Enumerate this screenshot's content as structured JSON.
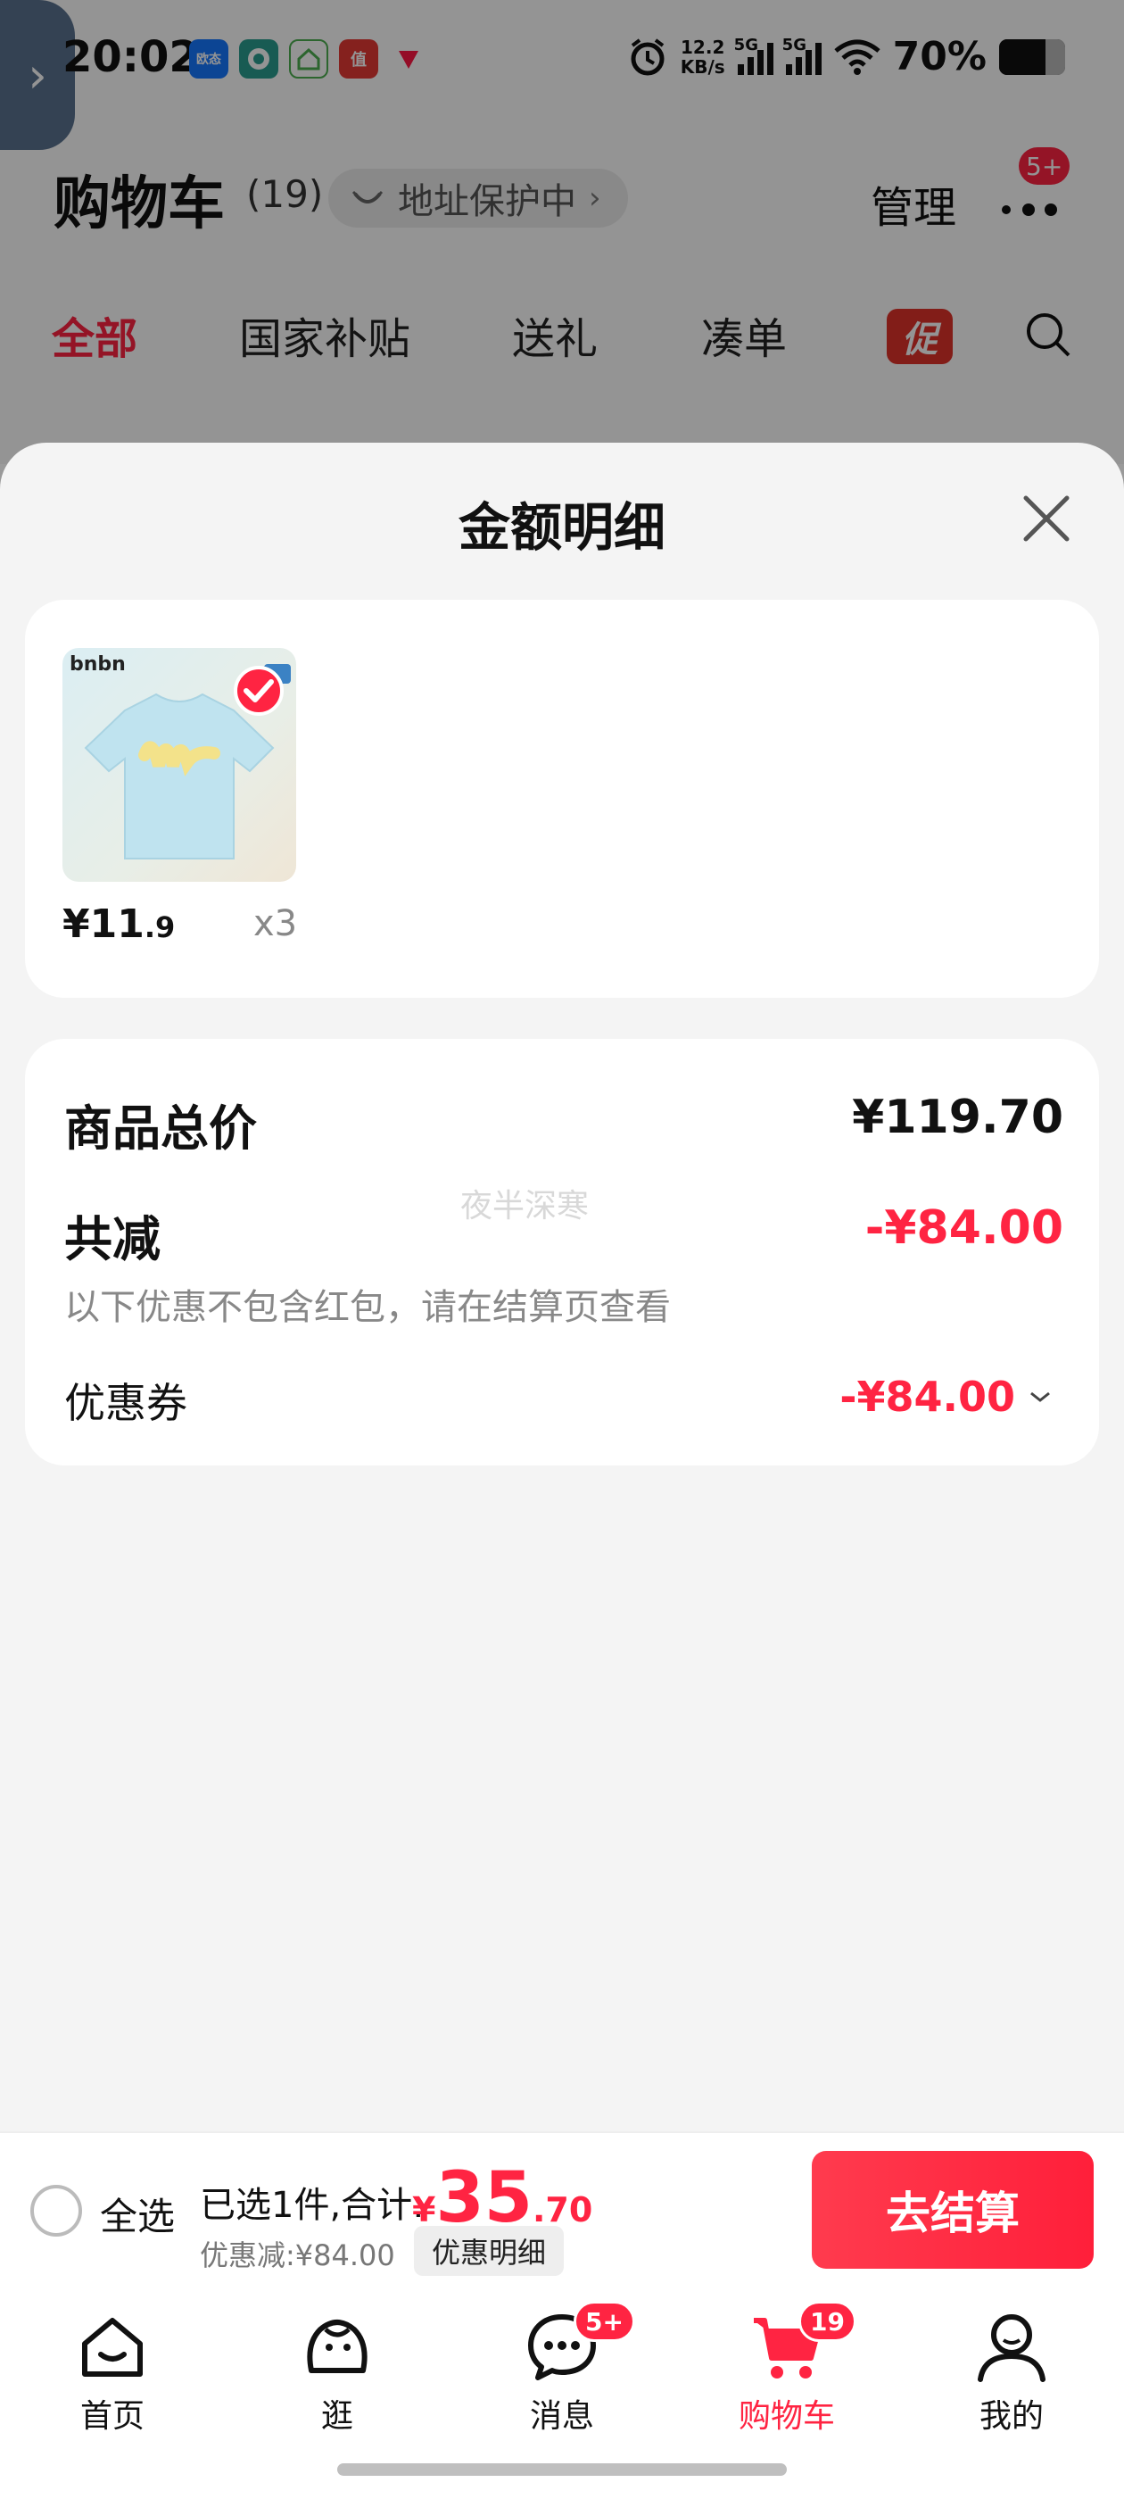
{
  "status_bar": {
    "time": "20:02",
    "network_speed_value": "12.2",
    "network_speed_unit": "KB/s",
    "sim1_label": "5G",
    "sim2_label": "5G",
    "battery": "70%",
    "battery_level": 0.7,
    "app_icons": [
      {
        "name": "alipay-icon",
        "label": "欧态",
        "color": "#1677ff"
      },
      {
        "name": "camera-app-icon",
        "label": "",
        "color": "#2a9d8f"
      },
      {
        "name": "home-app-icon",
        "label": "",
        "color": "#4caf50"
      },
      {
        "name": "zhi-app-icon",
        "label": "值",
        "color": "#e53935"
      },
      {
        "name": "red-arrow-app-icon",
        "label": "",
        "color": "#ff1744"
      }
    ]
  },
  "cart_header": {
    "title": "购物车",
    "count": "(19)",
    "address_protect": "地址保护中",
    "manage": "管理",
    "more_badge": "5+"
  },
  "category_tabs": [
    {
      "label": "全部",
      "active": true
    },
    {
      "label": "国家补贴",
      "active": false
    },
    {
      "label": "送礼",
      "active": false
    },
    {
      "label": "凑单",
      "active": false
    }
  ],
  "promo_tag": "促",
  "sheet": {
    "title": "金额明细",
    "item": {
      "brand": "bnbn",
      "price_int": "¥11",
      "price_dec": ".9",
      "quantity": "x3"
    },
    "summary": {
      "total_label": "商品总价",
      "total_value": "¥119.70",
      "reduce_label": "共减",
      "reduce_value": "-¥84.00",
      "reduce_note": "以下优惠不包含红包，请在结算页查看",
      "coupon_label": "优惠券",
      "coupon_value": "-¥84.00",
      "watermark": "夜半深寒"
    }
  },
  "checkout": {
    "select_all": "全选",
    "selected_text": "已选1件,合计:",
    "total_yen": "¥",
    "total_int": "35",
    "total_dec": ".70",
    "discount_text": "优惠减:¥84.00",
    "detail_button": "优惠明细",
    "checkout_button": "去结算"
  },
  "tabbar": [
    {
      "label": "首页",
      "icon": "home-icon",
      "badge": "",
      "active": false
    },
    {
      "label": "逛",
      "icon": "browse-icon",
      "badge": "",
      "active": false
    },
    {
      "label": "消息",
      "icon": "message-icon",
      "badge": "5+",
      "active": false
    },
    {
      "label": "购物车",
      "icon": "cart-icon",
      "badge": "19",
      "active": true
    },
    {
      "label": "我的",
      "icon": "profile-icon",
      "badge": "",
      "active": false
    }
  ],
  "colors": {
    "accent": "#ff2442",
    "sheet_bg": "#f4f4f4",
    "card_bg": "#ffffff"
  }
}
